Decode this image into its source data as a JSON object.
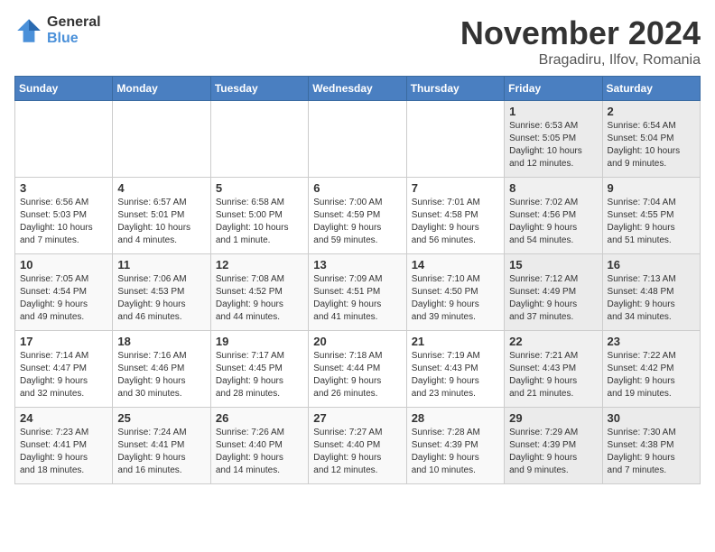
{
  "logo": {
    "general": "General",
    "blue": "Blue"
  },
  "title": {
    "month": "November 2024",
    "location": "Bragadiru, Ilfov, Romania"
  },
  "weekdays": [
    "Sunday",
    "Monday",
    "Tuesday",
    "Wednesday",
    "Thursday",
    "Friday",
    "Saturday"
  ],
  "weeks": [
    [
      {
        "day": "",
        "info": ""
      },
      {
        "day": "",
        "info": ""
      },
      {
        "day": "",
        "info": ""
      },
      {
        "day": "",
        "info": ""
      },
      {
        "day": "",
        "info": ""
      },
      {
        "day": "1",
        "info": "Sunrise: 6:53 AM\nSunset: 5:05 PM\nDaylight: 10 hours\nand 12 minutes."
      },
      {
        "day": "2",
        "info": "Sunrise: 6:54 AM\nSunset: 5:04 PM\nDaylight: 10 hours\nand 9 minutes."
      }
    ],
    [
      {
        "day": "3",
        "info": "Sunrise: 6:56 AM\nSunset: 5:03 PM\nDaylight: 10 hours\nand 7 minutes."
      },
      {
        "day": "4",
        "info": "Sunrise: 6:57 AM\nSunset: 5:01 PM\nDaylight: 10 hours\nand 4 minutes."
      },
      {
        "day": "5",
        "info": "Sunrise: 6:58 AM\nSunset: 5:00 PM\nDaylight: 10 hours\nand 1 minute."
      },
      {
        "day": "6",
        "info": "Sunrise: 7:00 AM\nSunset: 4:59 PM\nDaylight: 9 hours\nand 59 minutes."
      },
      {
        "day": "7",
        "info": "Sunrise: 7:01 AM\nSunset: 4:58 PM\nDaylight: 9 hours\nand 56 minutes."
      },
      {
        "day": "8",
        "info": "Sunrise: 7:02 AM\nSunset: 4:56 PM\nDaylight: 9 hours\nand 54 minutes."
      },
      {
        "day": "9",
        "info": "Sunrise: 7:04 AM\nSunset: 4:55 PM\nDaylight: 9 hours\nand 51 minutes."
      }
    ],
    [
      {
        "day": "10",
        "info": "Sunrise: 7:05 AM\nSunset: 4:54 PM\nDaylight: 9 hours\nand 49 minutes."
      },
      {
        "day": "11",
        "info": "Sunrise: 7:06 AM\nSunset: 4:53 PM\nDaylight: 9 hours\nand 46 minutes."
      },
      {
        "day": "12",
        "info": "Sunrise: 7:08 AM\nSunset: 4:52 PM\nDaylight: 9 hours\nand 44 minutes."
      },
      {
        "day": "13",
        "info": "Sunrise: 7:09 AM\nSunset: 4:51 PM\nDaylight: 9 hours\nand 41 minutes."
      },
      {
        "day": "14",
        "info": "Sunrise: 7:10 AM\nSunset: 4:50 PM\nDaylight: 9 hours\nand 39 minutes."
      },
      {
        "day": "15",
        "info": "Sunrise: 7:12 AM\nSunset: 4:49 PM\nDaylight: 9 hours\nand 37 minutes."
      },
      {
        "day": "16",
        "info": "Sunrise: 7:13 AM\nSunset: 4:48 PM\nDaylight: 9 hours\nand 34 minutes."
      }
    ],
    [
      {
        "day": "17",
        "info": "Sunrise: 7:14 AM\nSunset: 4:47 PM\nDaylight: 9 hours\nand 32 minutes."
      },
      {
        "day": "18",
        "info": "Sunrise: 7:16 AM\nSunset: 4:46 PM\nDaylight: 9 hours\nand 30 minutes."
      },
      {
        "day": "19",
        "info": "Sunrise: 7:17 AM\nSunset: 4:45 PM\nDaylight: 9 hours\nand 28 minutes."
      },
      {
        "day": "20",
        "info": "Sunrise: 7:18 AM\nSunset: 4:44 PM\nDaylight: 9 hours\nand 26 minutes."
      },
      {
        "day": "21",
        "info": "Sunrise: 7:19 AM\nSunset: 4:43 PM\nDaylight: 9 hours\nand 23 minutes."
      },
      {
        "day": "22",
        "info": "Sunrise: 7:21 AM\nSunset: 4:43 PM\nDaylight: 9 hours\nand 21 minutes."
      },
      {
        "day": "23",
        "info": "Sunrise: 7:22 AM\nSunset: 4:42 PM\nDaylight: 9 hours\nand 19 minutes."
      }
    ],
    [
      {
        "day": "24",
        "info": "Sunrise: 7:23 AM\nSunset: 4:41 PM\nDaylight: 9 hours\nand 18 minutes."
      },
      {
        "day": "25",
        "info": "Sunrise: 7:24 AM\nSunset: 4:41 PM\nDaylight: 9 hours\nand 16 minutes."
      },
      {
        "day": "26",
        "info": "Sunrise: 7:26 AM\nSunset: 4:40 PM\nDaylight: 9 hours\nand 14 minutes."
      },
      {
        "day": "27",
        "info": "Sunrise: 7:27 AM\nSunset: 4:40 PM\nDaylight: 9 hours\nand 12 minutes."
      },
      {
        "day": "28",
        "info": "Sunrise: 7:28 AM\nSunset: 4:39 PM\nDaylight: 9 hours\nand 10 minutes."
      },
      {
        "day": "29",
        "info": "Sunrise: 7:29 AM\nSunset: 4:39 PM\nDaylight: 9 hours\nand 9 minutes."
      },
      {
        "day": "30",
        "info": "Sunrise: 7:30 AM\nSunset: 4:38 PM\nDaylight: 9 hours\nand 7 minutes."
      }
    ]
  ]
}
